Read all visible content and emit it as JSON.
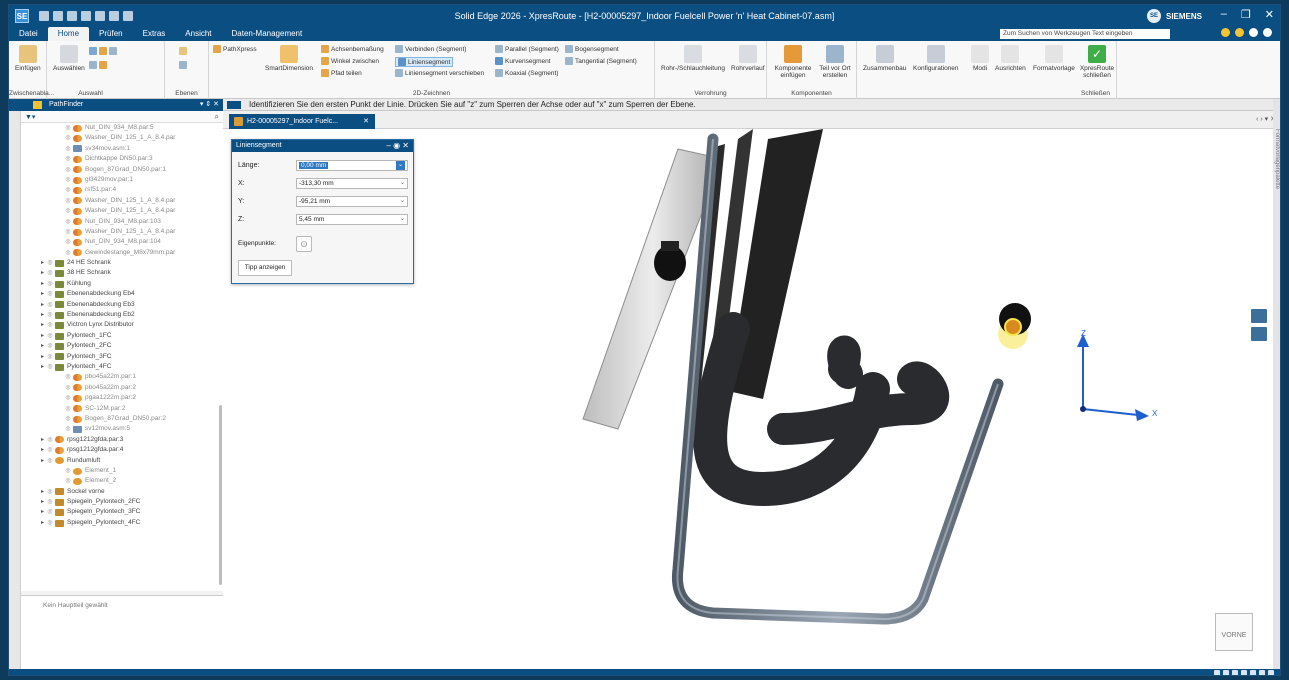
{
  "window": {
    "app_icon_label": "SE",
    "title": "Solid Edge 2026 - XpresRoute - [H2-00005297_Indoor Fuelcell Power 'n' Heat Cabinet-07.asm]",
    "brand": "SIEMENS",
    "brand_dot": "SE",
    "minimize": "–",
    "restore": "❐",
    "close": "✕"
  },
  "menu": {
    "tabs": [
      "Datei",
      "Home",
      "Prüfen",
      "Extras",
      "Ansicht",
      "Daten-Management"
    ],
    "active_tab": "Home",
    "command_search_placeholder": "Zum Suchen von Werkzeugen Text eingeben"
  },
  "ribbon": {
    "zwischenablage": {
      "label": "Zwischenabla...",
      "einfuegen": "Einfügen"
    },
    "auswahl": {
      "label": "Auswahl",
      "auswaehlen": "Auswählen"
    },
    "ebenen": {
      "label": "Ebenen"
    },
    "pathxpress": "PathXpress",
    "smartdimension": "SmartDimension",
    "zeichnen": {
      "label": "2D-Zeichnen",
      "achsenbemassung": "Achsenbemaßung",
      "winkel_zwischen": "Winkel zwischen",
      "pfad_teilen": "Pfad teilen",
      "verbinden": "Verbinden (Segment)",
      "liniensegment": "Liniensegment",
      "liniensegment_verschieben": "Liniensegment verschieben",
      "parallel": "Parallel (Segment)",
      "kurvensegment": "Kurvensegment",
      "koaxial": "Koaxial (Segment)",
      "bogensegment": "Bogensegment",
      "tangential": "Tangential (Segment)"
    },
    "verrohrung": {
      "label": "Verrohrung",
      "rohr_schlauch": "Rohr-/Schlauchleitung",
      "rohrverlauf": "Rohrverlauf"
    },
    "komponenten": {
      "label": "Komponenten",
      "komponente_einfuegen": "Komponente einfügen",
      "teil_vor_ort": "Teil vor Ort erstellen"
    },
    "zusammenbau": "Zusammenbau",
    "konfigurationen": "Konfigurationen",
    "modi": "Modi",
    "ausrichten": "Ausrichten",
    "formatvorlage": "Formatvorlage",
    "schliessen": {
      "label": "Schließen",
      "xpresroute_schliessen": "XpresRoute schließen"
    }
  },
  "pathfinder": {
    "title": "PathFinder",
    "status_message": "Kein Hauptteil gewählt",
    "items": [
      {
        "label": "Nut_DIN_934_M8.par:5",
        "icon": "part-icon",
        "dim": true
      },
      {
        "label": "Washer_DIN_125_1_A_8.4.par",
        "icon": "part-icon",
        "dim": true
      },
      {
        "label": "sv34mov.asm:1",
        "icon": "assembly-icon",
        "dim": true
      },
      {
        "label": "Dichtkappe DN50.par:3",
        "icon": "part-icon",
        "dim": true
      },
      {
        "label": "Bogen_87Grad_DN50.par:1",
        "icon": "part-icon",
        "dim": true
      },
      {
        "label": "gl3429mov.par:1",
        "icon": "part-icon",
        "dim": true
      },
      {
        "label": "rsf51.par:4",
        "icon": "part-icon",
        "dim": true
      },
      {
        "label": "Washer_DIN_125_1_A_8.4.par",
        "icon": "part-icon",
        "dim": true
      },
      {
        "label": "Washer_DIN_125_1_A_8.4.par",
        "icon": "part-icon",
        "dim": true
      },
      {
        "label": "Nut_DIN_934_M8.par:103",
        "icon": "part-icon",
        "dim": true
      },
      {
        "label": "Washer_DIN_125_1_A_8.4.par",
        "icon": "part-icon",
        "dim": true
      },
      {
        "label": "Nut_DIN_934_M8.par:104",
        "icon": "part-icon",
        "dim": true
      },
      {
        "label": "Gewindestange_M8x79mm.par",
        "icon": "part-icon",
        "dim": true
      },
      {
        "label": "24 HE Schrank",
        "icon": "subassembly-icon",
        "dim": false
      },
      {
        "label": "38 HE Schrank",
        "icon": "subassembly-icon",
        "dim": false
      },
      {
        "label": "Kühlung",
        "icon": "subassembly-icon",
        "dim": false
      },
      {
        "label": "Ebenenabdeckung Eb4",
        "icon": "subassembly-icon",
        "dim": false
      },
      {
        "label": "Ebenenabdeckung Eb3",
        "icon": "subassembly-icon",
        "dim": false
      },
      {
        "label": "Ebenenabdeckung Eb2",
        "icon": "subassembly-icon",
        "dim": false
      },
      {
        "label": "Victron Lynx Distributor",
        "icon": "subassembly-icon",
        "dim": false
      },
      {
        "label": "Pylontech_1FC",
        "icon": "subassembly-icon",
        "dim": false
      },
      {
        "label": "Pylontech_2FC",
        "icon": "subassembly-icon",
        "dim": false
      },
      {
        "label": "Pylontech_3FC",
        "icon": "subassembly-icon",
        "dim": false
      },
      {
        "label": "Pylontech_4FC",
        "icon": "subassembly-icon",
        "dim": false
      },
      {
        "label": "pbo45a22m.par:1",
        "icon": "part-icon",
        "dim": true
      },
      {
        "label": "pbo45a22m.par:2",
        "icon": "part-icon",
        "dim": true
      },
      {
        "label": "pgaa1222m.par:2",
        "icon": "part-icon",
        "dim": true
      },
      {
        "label": "SC-12M.par:2",
        "icon": "part-icon",
        "dim": true
      },
      {
        "label": "Bogen_87Grad_DN50.par:2",
        "icon": "part-icon",
        "dim": true
      },
      {
        "label": "sv12mov.asm:5",
        "icon": "assembly-icon",
        "dim": true
      },
      {
        "label": "rpsg1212gfda.par:3",
        "icon": "part-icon",
        "dim": false
      },
      {
        "label": "rpsg1212gfda.par:4",
        "icon": "part-icon",
        "dim": false
      },
      {
        "label": "Rundumluft",
        "icon": "folder-icon",
        "dim": false
      },
      {
        "label": "Element_1",
        "icon": "folder-icon",
        "dim": true
      },
      {
        "label": "Element_2",
        "icon": "folder-icon",
        "dim": true
      },
      {
        "label": "Sockel vorne",
        "icon": "mirror-icon",
        "dim": false
      },
      {
        "label": "Spiegeln_Pylontech_2FC",
        "icon": "mirror-icon",
        "dim": false
      },
      {
        "label": "Spiegeln_Pylontech_3FC",
        "icon": "mirror-icon",
        "dim": false
      },
      {
        "label": "Spiegeln_Pylontech_4FC",
        "icon": "mirror-icon",
        "dim": false
      }
    ]
  },
  "prompt": "Identifizieren Sie den ersten Punkt der Linie. Drücken Sie auf \"z\" zum Sperren der Achse oder auf \"x\" zum Sperren der Ebene.",
  "document_tab": "H2-00005297_Indoor Fuelc...",
  "right_pane_label": "Formatvorlagenpalette",
  "dialog": {
    "title": "Liniensegment",
    "laenge_label": "Länge:",
    "laenge_value": "0,00 mm",
    "x_label": "X:",
    "x_value": "-313,30 mm",
    "y_label": "Y:",
    "y_value": "-95,21 mm",
    "z_label": "Z:",
    "z_value": "5,45 mm",
    "eigenpunkte_label": "Eigenpunkte:",
    "tipp_button": "Tipp anzeigen"
  },
  "viewport": {
    "axis_x": "X",
    "axis_z": "Z",
    "view_cube_label": "VORNE"
  },
  "colors": {
    "accent": "#0b4e82",
    "pipe": "#6f7a88",
    "hose": "#2a2b2e",
    "highlight": "#f5e44a"
  }
}
